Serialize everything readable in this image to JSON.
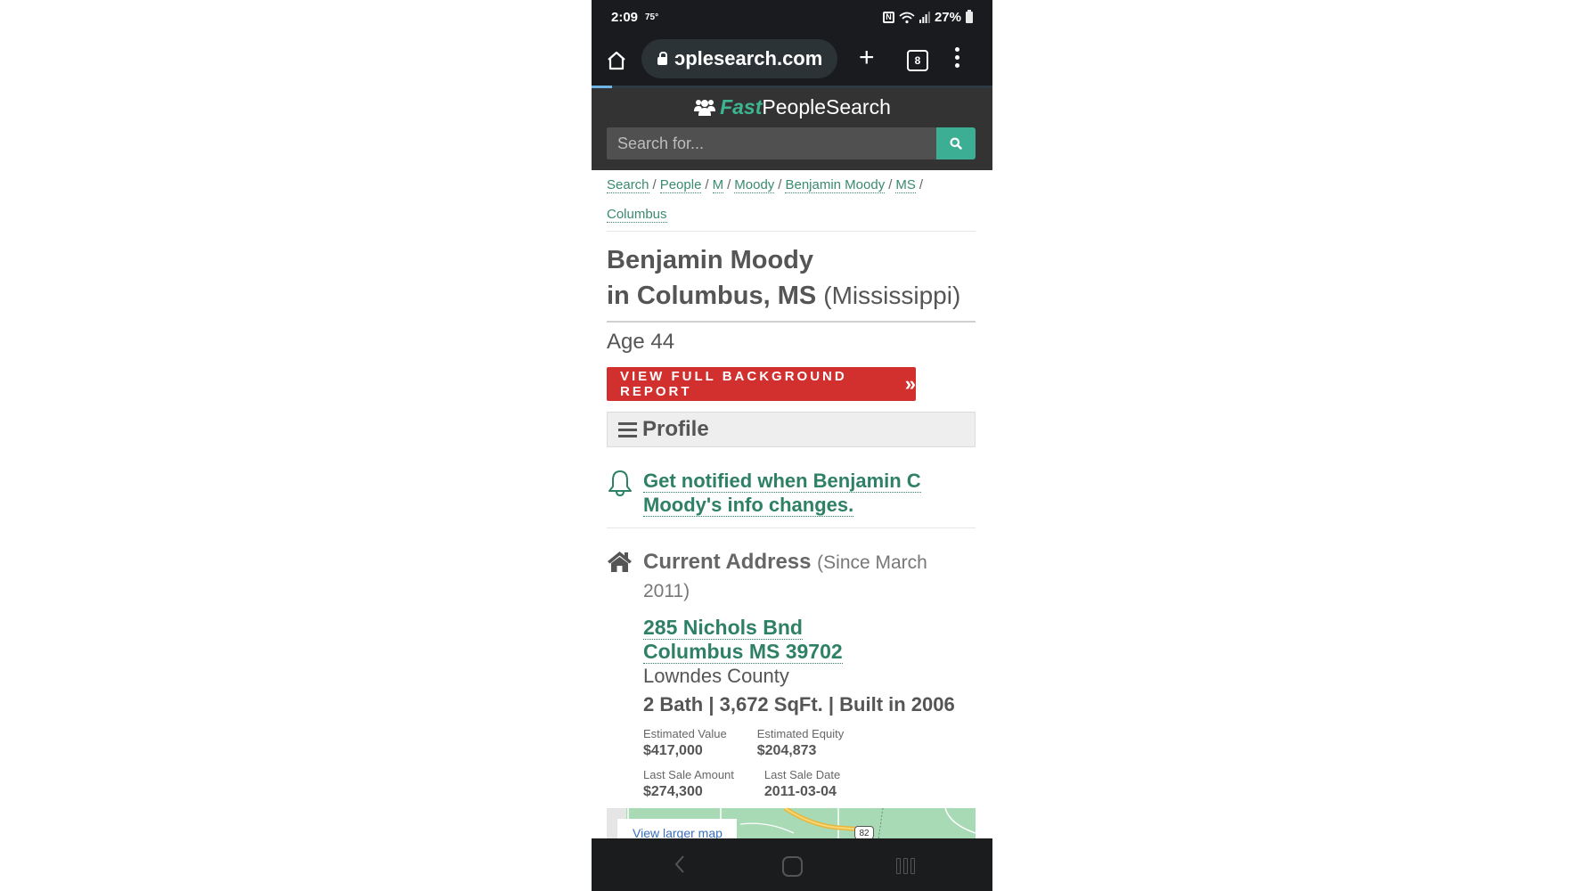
{
  "status_bar": {
    "time": "2:09",
    "temperature": "75°",
    "battery": "27%"
  },
  "browser": {
    "url": "ɔplesearch.com",
    "tab_count": "8",
    "progress_percent": 5
  },
  "site": {
    "logo_fast": "Fast",
    "logo_rest": "PeopleSearch",
    "search_placeholder": "Search for...",
    "accent_color": "#3cae94"
  },
  "breadcrumb": [
    {
      "label": "Search"
    },
    {
      "label": "People"
    },
    {
      "label": "M"
    },
    {
      "label": "Moody"
    },
    {
      "label": "Benjamin Moody"
    },
    {
      "label": "MS"
    },
    {
      "label": "Columbus"
    }
  ],
  "breadcrumb_separator": "/",
  "person": {
    "name": "Benjamin Moody",
    "location_prefix": "in Columbus, MS",
    "state_full": "(Mississippi)",
    "age_label": "Age 44"
  },
  "report_button": {
    "label": "VIEW FULL BACKGROUND REPORT",
    "chevron": "»",
    "color": "#d22f2f"
  },
  "profile_section": {
    "title": "Profile"
  },
  "notify": {
    "line1": "Get notified when Benjamin C",
    "line2": "Moody's info changes."
  },
  "current_address": {
    "heading": "Current Address",
    "since": "(Since March 2011)",
    "street": "285 Nichols Bnd",
    "city_state_zip": "Columbus MS 39702",
    "county": "Lowndes County",
    "facts": "2 Bath | 3,672 SqFt. | Built in 2006",
    "details": [
      {
        "label": "Estimated Value",
        "value": "$417,000"
      },
      {
        "label": "Estimated Equity",
        "value": "$204,873"
      },
      {
        "label": "Last Sale Amount",
        "value": "$274,300"
      },
      {
        "label": "Last Sale Date",
        "value": "2011-03-04"
      }
    ]
  },
  "map": {
    "view_larger_label": "View larger map",
    "route_shield": "82"
  }
}
